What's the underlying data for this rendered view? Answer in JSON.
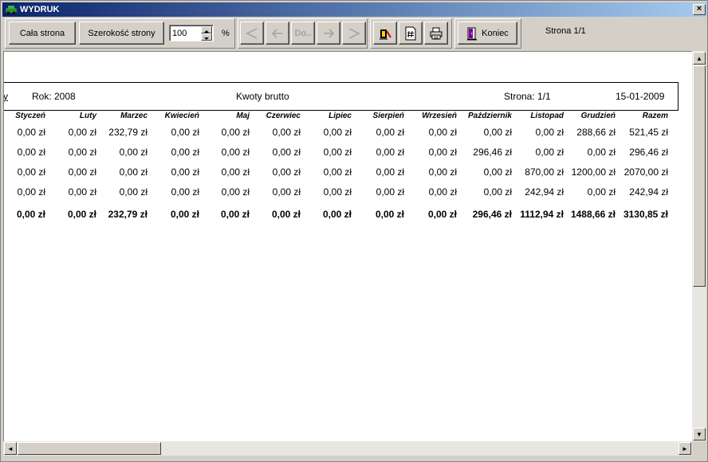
{
  "window": {
    "title": "WYDRUK",
    "close_glyph": "×"
  },
  "toolbar": {
    "whole_page": "Cała strona",
    "page_width": "Szerokość strony",
    "zoom_value": "100",
    "percent": "%",
    "goto": "Do..",
    "end": "Koniec",
    "page_status": "Strona 1/1"
  },
  "report": {
    "left_fragment": "y",
    "year": "Rok: 2008",
    "amount_type": "Kwoty brutto",
    "page": "Strona: 1/1",
    "date": "15-01-2009",
    "columns": [
      "Styczeń",
      "Luty",
      "Marzec",
      "Kwiecień",
      "Maj",
      "Czerwiec",
      "Lipiec",
      "Sierpień",
      "Wrzesień",
      "Październik",
      "Listopad",
      "Grudzień",
      "Razem"
    ],
    "rows": [
      [
        "0,00 zł",
        "0,00 zł",
        "232,79 zł",
        "0,00 zł",
        "0,00 zł",
        "0,00 zł",
        "0,00 zł",
        "0,00 zł",
        "0,00 zł",
        "0,00 zł",
        "0,00 zł",
        "288,66 zł",
        "521,45 zł"
      ],
      [
        "0,00 zł",
        "0,00 zł",
        "0,00 zł",
        "0,00 zł",
        "0,00 zł",
        "0,00 zł",
        "0,00 zł",
        "0,00 zł",
        "0,00 zł",
        "296,46 zł",
        "0,00 zł",
        "0,00 zł",
        "296,46 zł"
      ],
      [
        "0,00 zł",
        "0,00 zł",
        "0,00 zł",
        "0,00 zł",
        "0,00 zł",
        "0,00 zł",
        "0,00 zł",
        "0,00 zł",
        "0,00 zł",
        "0,00 zł",
        "870,00 zł",
        "1200,00 zł",
        "2070,00 zł"
      ],
      [
        "0,00 zł",
        "0,00 zł",
        "0,00 zł",
        "0,00 zł",
        "0,00 zł",
        "0,00 zł",
        "0,00 zł",
        "0,00 zł",
        "0,00 zł",
        "0,00 zł",
        "242,94 zł",
        "0,00 zł",
        "242,94 zł"
      ]
    ],
    "totals": [
      "0,00 zł",
      "0,00 zł",
      "232,79 zł",
      "0,00 zł",
      "0,00 zł",
      "0,00 zł",
      "0,00 zł",
      "0,00 zł",
      "0,00 zł",
      "296,46 zł",
      "1112,94 zł",
      "1488,66 zł",
      "3130,85 zł"
    ]
  },
  "scroll": {
    "up": "▲",
    "down": "▼",
    "left": "◄",
    "right": "►"
  }
}
